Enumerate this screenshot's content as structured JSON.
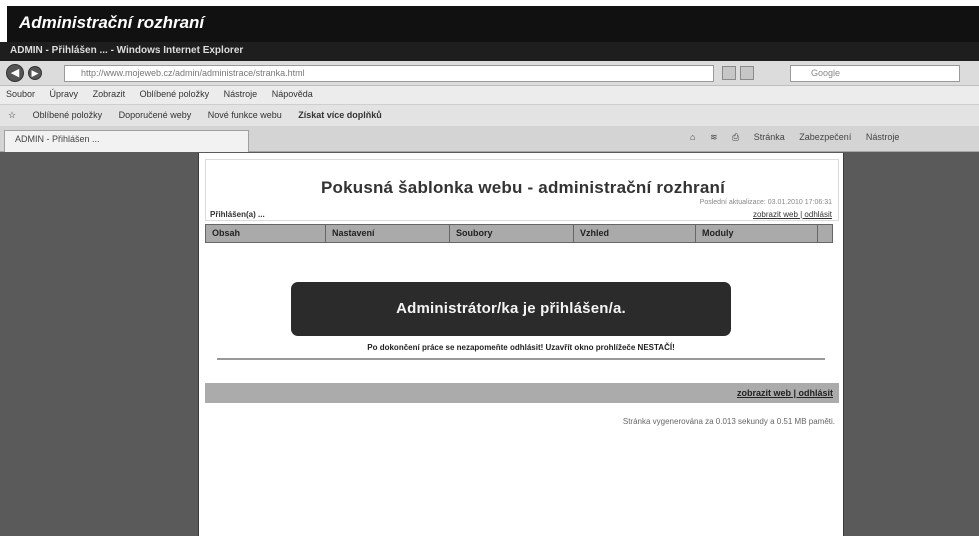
{
  "caption": {
    "title": "Administrační rozhraní"
  },
  "browser": {
    "window_title": "ADMIN - Přihlášen ... - Windows Internet Explorer",
    "address": "http://www.mojeweb.cz/admin/administrace/stranka.html",
    "search_placeholder": "Google",
    "menu": [
      "Soubor",
      "Úpravy",
      "Zobrazit",
      "Oblíbené položky",
      "Nástroje",
      "Nápověda"
    ],
    "favorites": [
      "Oblíbené položky",
      "Doporučené weby",
      "Nové funkce webu"
    ],
    "favorites_bold": "Získat více doplňků",
    "tab_label": "ADMIN - Přihlášen ...",
    "commands": [
      "Stránka",
      "Zabezpečení",
      "Nástroje"
    ]
  },
  "page": {
    "title": "Pokusná šablonka webu - administrační rozhraní",
    "updated": "Poslední aktualizace: 03.01.2010 17:06:31",
    "logged_in": "Přihlášen(a) ...",
    "header_link": "zobrazit web | odhlásit",
    "nav": [
      "Obsah",
      "Nastavení",
      "Soubory",
      "Vzhled",
      "Moduly"
    ],
    "notice": "Administrátor/ka je přihlášen/a.",
    "hint": "Po dokončení práce se nezapomeňte odhlásit! Uzavřít okno prohlížeče NESTAČÍ!",
    "footer_link": "zobrazit web | odhlásit",
    "generated": "Stránka vygenerována za 0.013 sekundy a 0.51 MB paměti."
  }
}
